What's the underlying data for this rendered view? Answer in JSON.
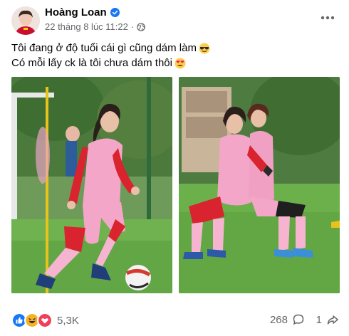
{
  "post": {
    "author": "Hoàng Loan",
    "date": "22 tháng 8 lúc 11:22",
    "separator": "·",
    "text_line1": "Tôi đang ở độ tuổi cái gì cũng dám làm",
    "text_line2": "Có mỗi lấy ck là tôi chưa dám thôi",
    "emoji_line1": "sunglasses-emoji",
    "emoji_line2": "heart-eyes-emoji"
  },
  "reactions": {
    "icons": [
      "like-icon",
      "haha-icon",
      "love-icon"
    ],
    "count": "5,3K"
  },
  "comments": {
    "count": "268",
    "icon": "comment-icon"
  },
  "shares": {
    "count": "1",
    "icon": "share-icon"
  },
  "colors": {
    "verified": "#1877f2",
    "meta_text": "#65676b",
    "jersey_pink": "#f4a6c8",
    "sleeve_red": "#d9232e",
    "grass_green": "#5fa84a"
  }
}
